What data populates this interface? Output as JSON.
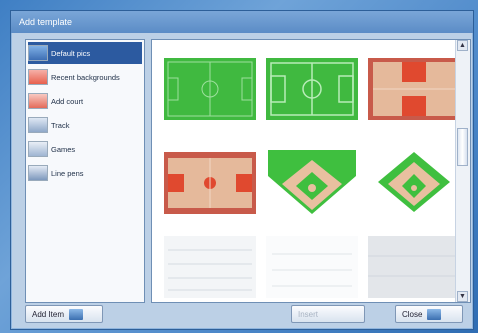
{
  "window": {
    "title": "Add template"
  },
  "categories": [
    {
      "label": "Default pics",
      "icon": "field-icon",
      "selected": true
    },
    {
      "label": "Recent backgrounds",
      "icon": "sport-icon",
      "selected": false
    },
    {
      "label": "Add court",
      "icon": "court-icon",
      "selected": false
    },
    {
      "label": "Track",
      "icon": "track-icon",
      "selected": false
    },
    {
      "label": "Games",
      "icon": "game-icon",
      "selected": false
    },
    {
      "label": "Line pens",
      "icon": "lines-icon",
      "selected": false
    }
  ],
  "gallery": {
    "items": [
      "soccer-field-icon",
      "soccer-field-alt-icon",
      "basketball-half-court-icon",
      "basketball-court-icon",
      "baseball-field-icon",
      "baseball-diamond-icon",
      "blank-lined-icon",
      "blank-lined-thin-icon",
      "blank-grey-icon"
    ]
  },
  "buttons": {
    "add_item": "Add Item",
    "middle": "Insert",
    "close": "Close"
  },
  "colors": {
    "field_green": "#3fbf3f",
    "court_tan": "#e2b79a",
    "court_red": "#e0492f",
    "dirt": "#e8c0a0"
  }
}
